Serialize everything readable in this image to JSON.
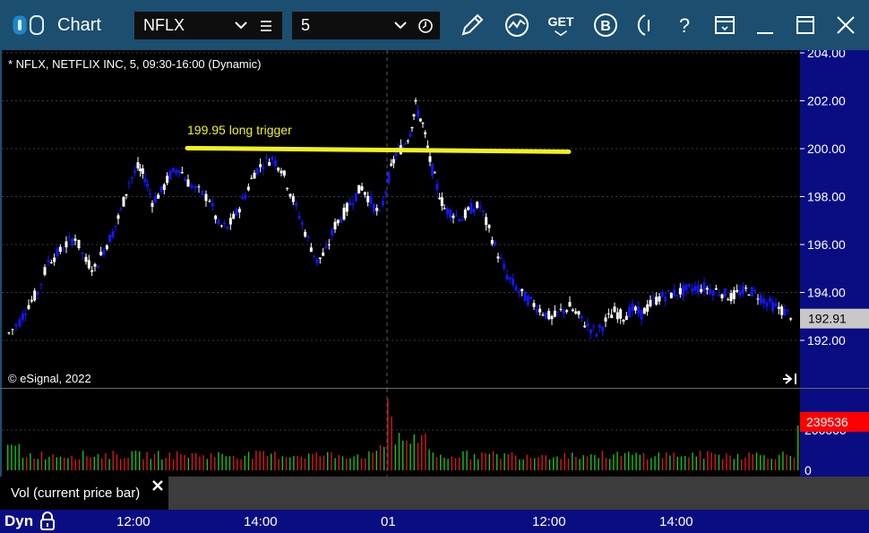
{
  "toolbar": {
    "title": "Chart",
    "symbol": "NFLX",
    "interval": "5",
    "icons": [
      "app-toggle-icon",
      "list-icon",
      "clock-icon",
      "draw-pencil-icon",
      "study-icon",
      "get-icon",
      "b-icon",
      "info-icon",
      "help-icon",
      "template-icon",
      "minimize-icon",
      "maximize-icon",
      "close-icon"
    ],
    "get_label": "GET",
    "b_label": "B",
    "help_label": "?"
  },
  "chart": {
    "header": "* NFLX, NETFLIX INC, 5, 09:30-16:00 (Dynamic)",
    "watermark": "© eSignal, 2022",
    "annotation": "199.95 long trigger",
    "trigger_price": 199.95,
    "last_price_label": "192.91",
    "last_price": 192.91,
    "price_ticks": [
      "204.00",
      "202.00",
      "200.00",
      "198.00",
      "196.00",
      "194.00",
      "192.00"
    ],
    "price_tick_values": [
      204,
      202,
      200,
      198,
      196,
      194,
      192
    ],
    "colors": {
      "up": "#ffffff",
      "down": "#1515ff",
      "trigger_line": "#f2f21a",
      "annotation_text": "#f2f21a",
      "grid": "#3a3a3a",
      "price_axis_bg": "#0a0d82",
      "last_price_bg": "#c8c8c8"
    }
  },
  "volume": {
    "label": "Vol (current price bar)",
    "last_volume_label": "239536",
    "axis_ticks": [
      "200000",
      "0"
    ],
    "colors": {
      "up": "#19c019",
      "down": "#d81818",
      "badge_bg": "#ff0000"
    }
  },
  "time_axis": {
    "mode_label": "Dyn",
    "labels": [
      "12:00",
      "14:00",
      "01",
      "12:00",
      "14:00"
    ]
  }
}
